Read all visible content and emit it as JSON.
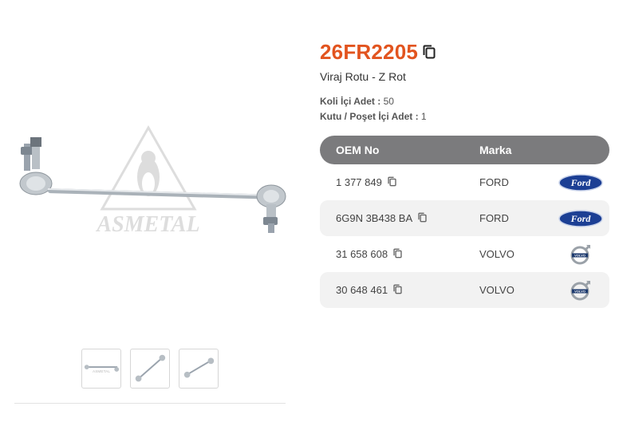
{
  "product": {
    "code": "26FR2205",
    "name": "Viraj Rotu - Z Rot",
    "koli_label": "Koli İçi Adet :",
    "koli_value": "50",
    "kutu_label": "Kutu / Poşet İçi Adet :",
    "kutu_value": "1"
  },
  "gallery": {
    "watermark": "ASMETAL",
    "thumbnails": [
      "thumb-1",
      "thumb-2",
      "thumb-3"
    ]
  },
  "oem_table": {
    "headers": {
      "oem": "OEM No",
      "brand": "Marka"
    },
    "rows": [
      {
        "oem": "1 377 849",
        "brand": "FORD",
        "logo": "ford-logo"
      },
      {
        "oem": "6G9N 3B438 BA",
        "brand": "FORD",
        "logo": "ford-logo"
      },
      {
        "oem": "31 658 608",
        "brand": "VOLVO",
        "logo": "volvo-logo"
      },
      {
        "oem": "30 648 461",
        "brand": "VOLVO",
        "logo": "volvo-logo"
      }
    ]
  },
  "colors": {
    "accent": "#e2541f",
    "header_bg": "#7b7b7d",
    "row_alt": "#f2f2f2",
    "ford_blue": "#1c3f94"
  }
}
